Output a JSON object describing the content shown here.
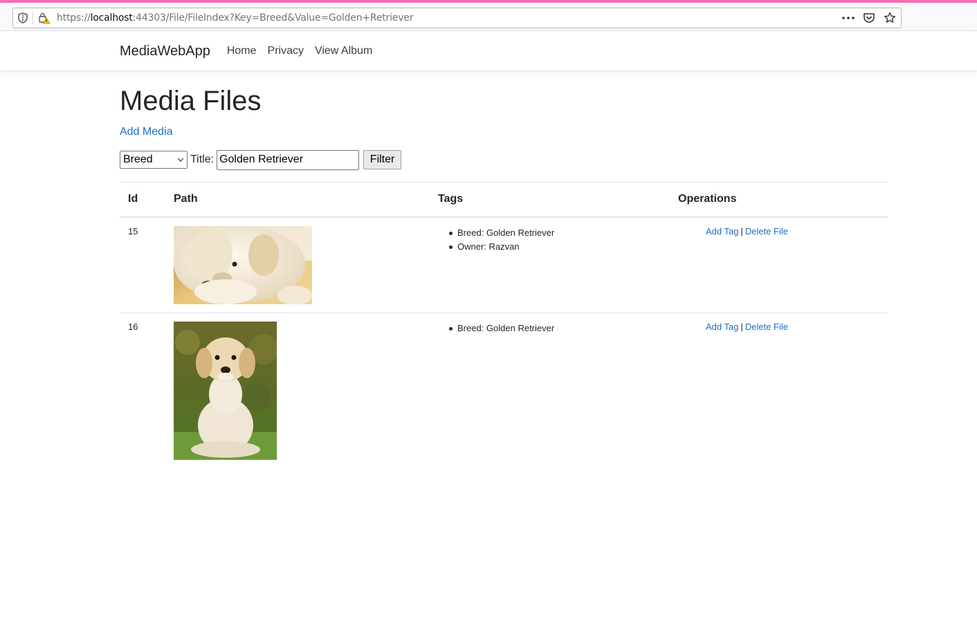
{
  "browser": {
    "url_prefix": "https://",
    "url_host": "localhost",
    "url_rest": ":44303/File/FileIndex?Key=Breed&Value=Golden+Retriever"
  },
  "nav": {
    "brand": "MediaWebApp",
    "links": [
      "Home",
      "Privacy",
      "View Album"
    ]
  },
  "page": {
    "title": "Media Files",
    "add_media": "Add Media"
  },
  "filter": {
    "select_value": "Breed",
    "title_label": "Title:",
    "title_value": "Golden Retriever",
    "button": "Filter"
  },
  "table": {
    "headers": [
      "Id",
      "Path",
      "Tags",
      "Operations"
    ],
    "rows": [
      {
        "id": "15",
        "tags": [
          "Breed: Golden Retriever",
          "Owner: Razvan"
        ],
        "op_add": "Add Tag",
        "op_sep": "|",
        "op_delete": "Delete File"
      },
      {
        "id": "16",
        "tags": [
          "Breed: Golden Retriever"
        ],
        "op_add": "Add Tag",
        "op_sep": "|",
        "op_delete": "Delete File"
      }
    ]
  },
  "colors": {
    "accent": "#f16fb5",
    "link": "#1b6ec2"
  }
}
